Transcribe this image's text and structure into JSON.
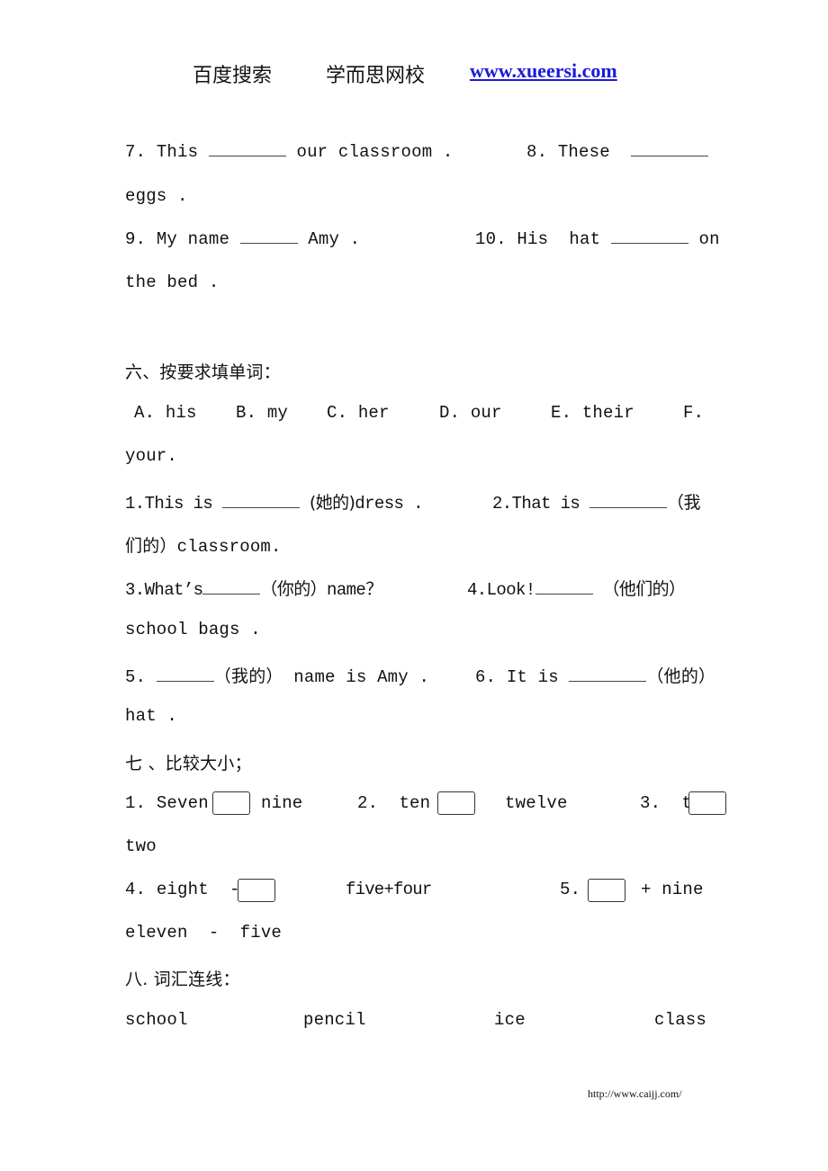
{
  "header": {
    "search_label": "百度搜索",
    "school_name": "学而思网校",
    "link_text": "www.xueersi.com",
    "link_color": "#1a1adb"
  },
  "section5_continued": {
    "items": [
      {
        "number": "7.",
        "before": "This",
        "after": "our classroom ."
      },
      {
        "number": "8.",
        "before": "These",
        "after": "eggs ."
      },
      {
        "number": "9.",
        "before": "My name",
        "after": "Amy ."
      },
      {
        "number": "10.",
        "before": "His  hat",
        "after_line1": "on",
        "after_line2": "the bed ."
      }
    ]
  },
  "section6": {
    "title": "六、按要求填单词：",
    "options": [
      {
        "letter": "A.",
        "word": "his"
      },
      {
        "letter": "B.",
        "word": "my"
      },
      {
        "letter": "C.",
        "word": "her"
      },
      {
        "letter": "D.",
        "word": "our"
      },
      {
        "letter": "E.",
        "word": "their"
      },
      {
        "letter": "F.",
        "word": "your."
      }
    ],
    "items": [
      {
        "number": "1.",
        "before": "This is",
        "hint": "(她的)",
        "after": "dress ."
      },
      {
        "number": "2.",
        "before": "That is",
        "hint_line1": "（我",
        "hint_line2": "们的）",
        "after": "classroom."
      },
      {
        "number": "3.",
        "before": "What’s",
        "hint": "（你的）",
        "after": "name？"
      },
      {
        "number": "4.",
        "before": "Look!",
        "hint": "（他们的）",
        "after": "school bags ."
      },
      {
        "number": "5.",
        "before": "",
        "hint": "（我的）",
        "after": "name is Amy ."
      },
      {
        "number": "6.",
        "before": "It is",
        "hint": "（他的）",
        "after": "hat ."
      }
    ]
  },
  "section7": {
    "title": "七 、比较大小；",
    "items": [
      {
        "number": "1.",
        "left": "Seven",
        "right": "nine"
      },
      {
        "number": "2.",
        "left": "ten",
        "right": "twelve"
      },
      {
        "number": "3.",
        "left": "th",
        "right": "two"
      },
      {
        "number": "4.",
        "left": "eight  -",
        "right": "five+four"
      },
      {
        "number": "5.",
        "left": "",
        "right_line1": "+ nine",
        "right_line2": "eleven  -  five"
      }
    ]
  },
  "section8": {
    "title": "八. 词汇连线：",
    "words": [
      "school",
      "pencil",
      "ice",
      "class"
    ]
  },
  "footer": {
    "url_text": "http://www.caijj.com/"
  }
}
